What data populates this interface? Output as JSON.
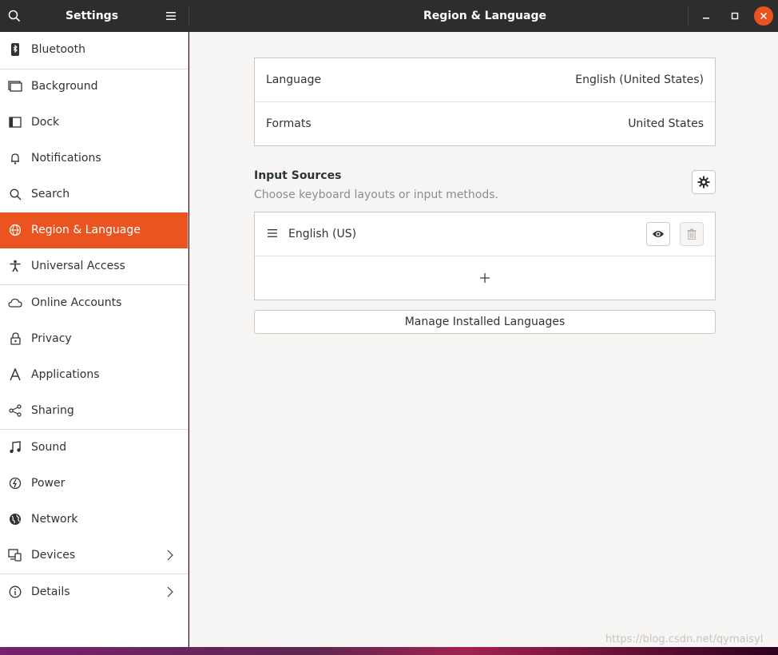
{
  "titlebar": {
    "left_title": "Settings",
    "title": "Region & Language"
  },
  "sidebar": {
    "items": [
      {
        "label": "Bluetooth",
        "icon": "bluetooth-icon"
      },
      {
        "label": "Background",
        "icon": "background-icon"
      },
      {
        "label": "Dock",
        "icon": "dock-icon"
      },
      {
        "label": "Notifications",
        "icon": "bell-icon"
      },
      {
        "label": "Search",
        "icon": "search-icon"
      },
      {
        "label": "Region & Language",
        "icon": "globe-icon",
        "active": true
      },
      {
        "label": "Universal Access",
        "icon": "accessibility-icon"
      },
      {
        "label": "Online Accounts",
        "icon": "cloud-icon"
      },
      {
        "label": "Privacy",
        "icon": "lock-icon"
      },
      {
        "label": "Applications",
        "icon": "applications-icon"
      },
      {
        "label": "Sharing",
        "icon": "share-icon"
      },
      {
        "label": "Sound",
        "icon": "music-note-icon"
      },
      {
        "label": "Power",
        "icon": "power-icon"
      },
      {
        "label": "Network",
        "icon": "network-globe-icon"
      },
      {
        "label": "Devices",
        "icon": "devices-icon"
      },
      {
        "label": "Details",
        "icon": "info-icon"
      }
    ]
  },
  "language_card": {
    "language_label": "Language",
    "language_value": "English (United States)",
    "formats_label": "Formats",
    "formats_value": "United States"
  },
  "input_sources": {
    "title": "Input Sources",
    "subtitle": "Choose keyboard layouts or input methods.",
    "sources": [
      {
        "label": "English (US)"
      }
    ]
  },
  "manage_button": "Manage Installed Languages",
  "watermark": "https://blog.csdn.net/qymaisyl",
  "colors": {
    "accent": "#e95420",
    "titlebar": "#2d2d2d"
  }
}
